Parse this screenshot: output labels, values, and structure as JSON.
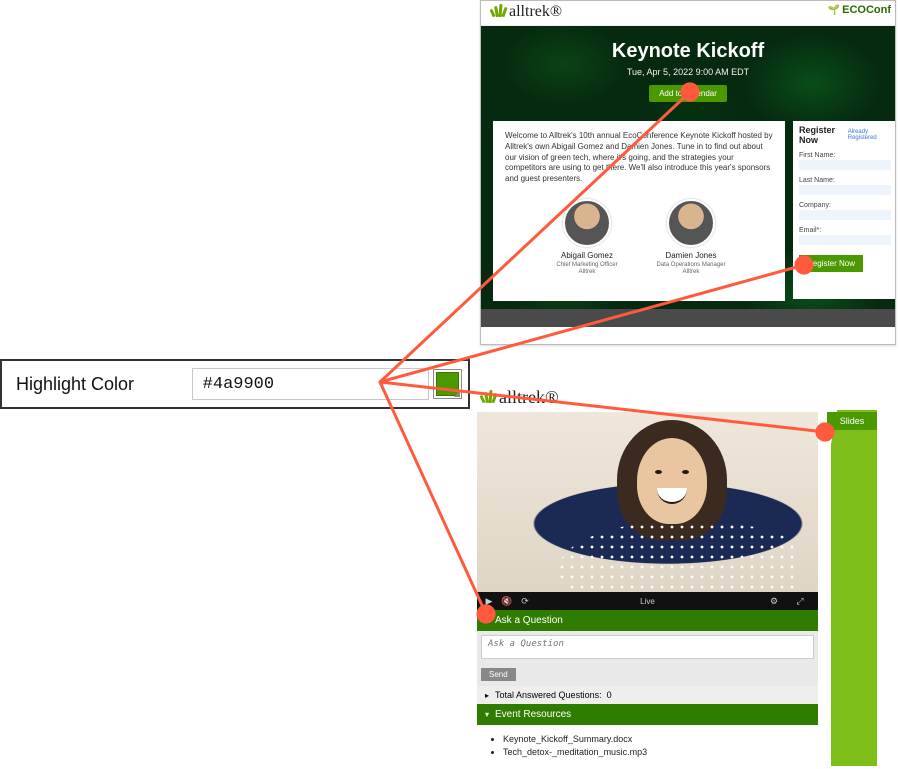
{
  "control": {
    "label": "Highlight Color",
    "value": "#4a9900",
    "swatch_color": "#4a9900"
  },
  "brand_name": "alltrek",
  "eco_tag": "ECOConf",
  "preview_landing": {
    "hero_title": "Keynote Kickoff",
    "hero_subtitle": "Tue, Apr 5, 2022 9:00 AM EDT",
    "add_calendar_btn": "Add to Calendar",
    "welcome_text": "Welcome to Alltrek's 10th annual EcoConference Keynote Kickoff hosted by Alltrek's own Abigail Gomez and Damien Jones. Tune in to find out about our vision of green tech, where it's going, and the strategies your competitors are using to get there. We'll also introduce this year's sponsors and guest presenters.",
    "presenters": [
      {
        "name": "Abigail Gomez",
        "title": "Chief Marketing Officer",
        "org": "Alltrek"
      },
      {
        "name": "Damien Jones",
        "title": "Data Operations Manager",
        "org": "Alltrek"
      }
    ],
    "form": {
      "heading": "Register Now",
      "already": "Already Registered",
      "fields": [
        "First Name:",
        "Last Name:",
        "Company:",
        "Email*:"
      ],
      "submit": "Register Now"
    }
  },
  "preview_viewer": {
    "slides_tab": "Slides",
    "controls": {
      "play": "▶",
      "mute": "🔇",
      "refresh": "⟳",
      "live_label": "Live",
      "settings": "⚙",
      "fullscreen": "⤢"
    },
    "ask_header": "Ask a Question",
    "ask_placeholder": "Ask a Question",
    "send_btn": "Send",
    "total_answered_label": "Total Answered Questions:",
    "total_answered_count": "0",
    "resources_header": "Event Resources",
    "resources": [
      "Keynote_Kickoff_Summary.docx",
      "Tech_detox-_meditation_music.mp3"
    ]
  }
}
